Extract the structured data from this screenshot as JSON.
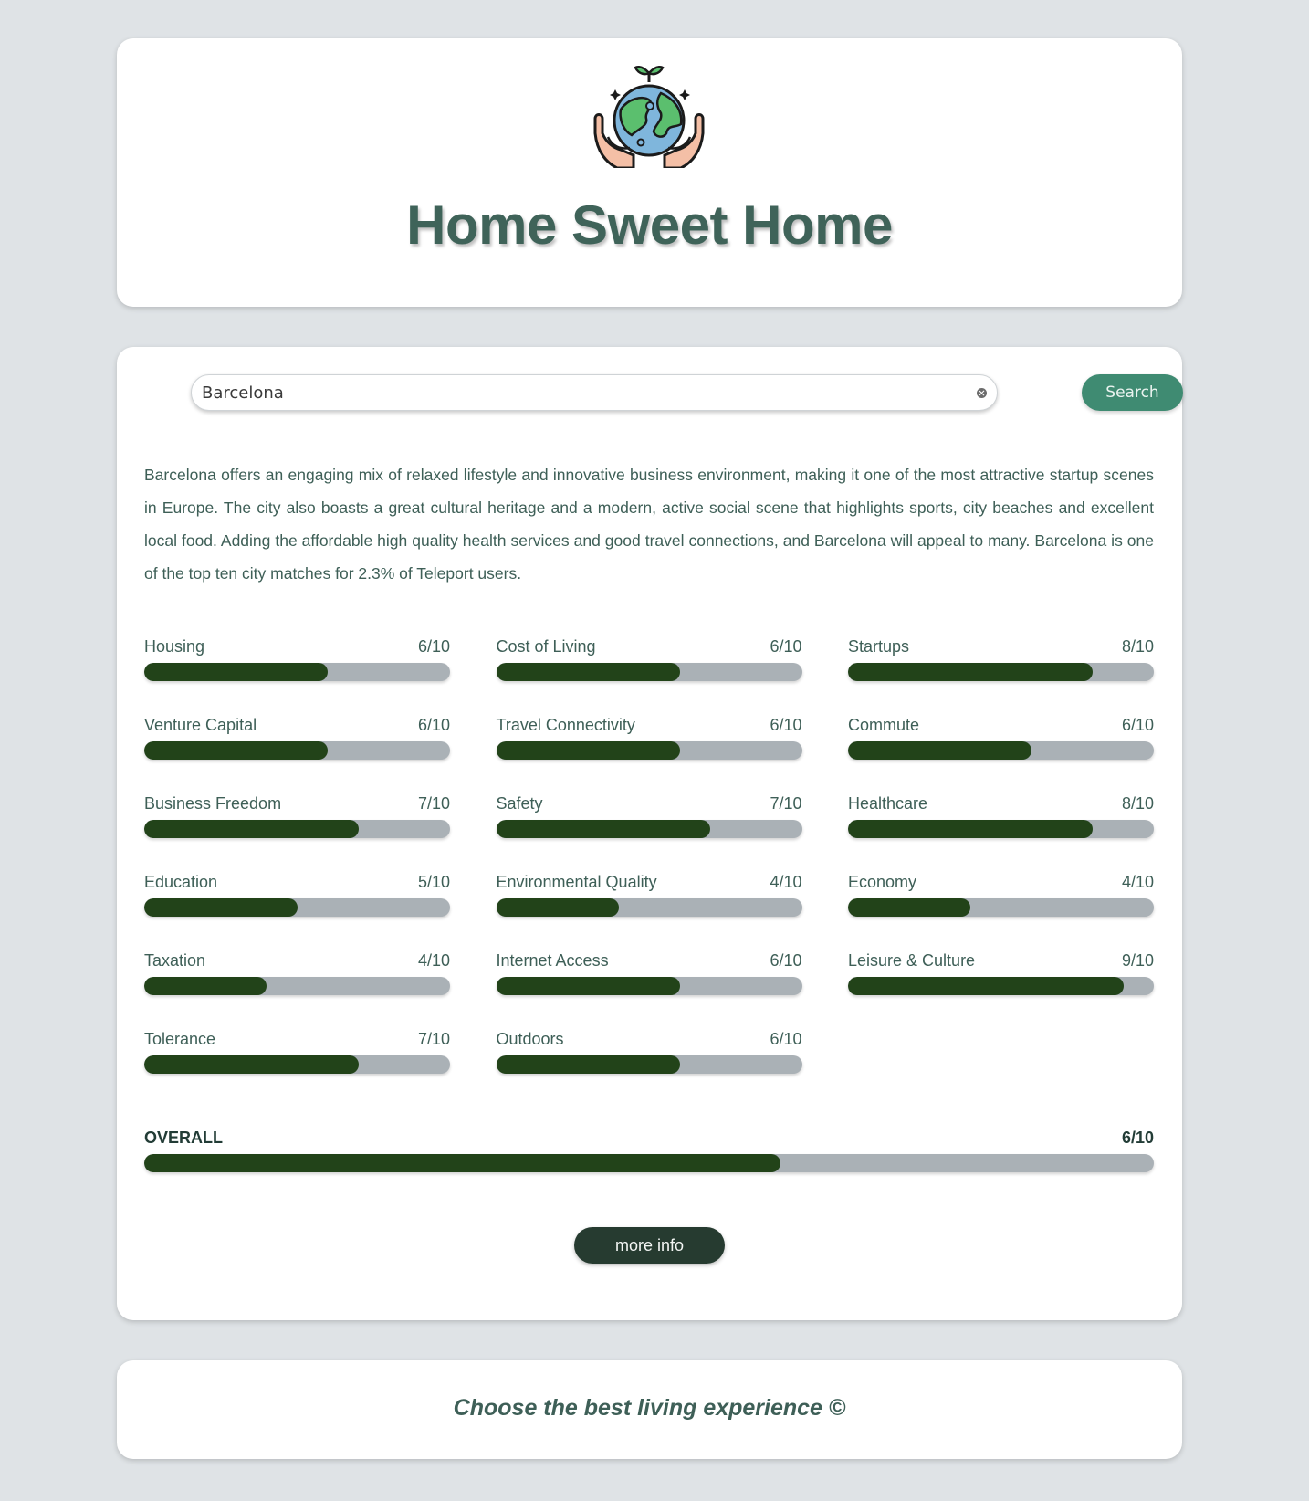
{
  "header": {
    "logo_icon": "earth-in-hands-icon",
    "title": "Home Sweet Home"
  },
  "search": {
    "value": "Barcelona",
    "button_label": "Search"
  },
  "summary": "Barcelona offers an engaging mix of relaxed lifestyle and innovative business environment, making it one of the most attractive startup scenes in Europe. The city also boasts a great cultural heritage and a modern, active social scene that highlights sports, city beaches and excellent local food. Adding the affordable high quality health services and good travel connections, and Barcelona will appeal to many. Barcelona is one of the top ten city matches for 2.3% of Teleport users.",
  "scores": [
    {
      "label": "Housing",
      "value": "6/10",
      "score": 6
    },
    {
      "label": "Cost of Living",
      "value": "6/10",
      "score": 6
    },
    {
      "label": "Startups",
      "value": "8/10",
      "score": 8
    },
    {
      "label": "Venture Capital",
      "value": "6/10",
      "score": 6
    },
    {
      "label": "Travel Connectivity",
      "value": "6/10",
      "score": 6
    },
    {
      "label": "Commute",
      "value": "6/10",
      "score": 6
    },
    {
      "label": "Business Freedom",
      "value": "7/10",
      "score": 7
    },
    {
      "label": "Safety",
      "value": "7/10",
      "score": 7
    },
    {
      "label": "Healthcare",
      "value": "8/10",
      "score": 8
    },
    {
      "label": "Education",
      "value": "5/10",
      "score": 5
    },
    {
      "label": "Environmental Quality",
      "value": "4/10",
      "score": 4
    },
    {
      "label": "Economy",
      "value": "4/10",
      "score": 4
    },
    {
      "label": "Taxation",
      "value": "4/10",
      "score": 4
    },
    {
      "label": "Internet Access",
      "value": "6/10",
      "score": 6
    },
    {
      "label": "Leisure & Culture",
      "value": "9/10",
      "score": 9
    },
    {
      "label": "Tolerance",
      "value": "7/10",
      "score": 7
    },
    {
      "label": "Outdoors",
      "value": "6/10",
      "score": 6
    }
  ],
  "overall": {
    "label": "OVERALL",
    "value": "6/10",
    "score": 6.3
  },
  "more_info_label": "more info",
  "footer": {
    "text": "Choose the best living experience ©"
  },
  "colors": {
    "background": "#dfe3e6",
    "accent": "#3f8b72",
    "bar_fill": "#224319",
    "bar_track": "#aab1b6",
    "dark_button": "#263b30",
    "title": "#3f6359"
  }
}
